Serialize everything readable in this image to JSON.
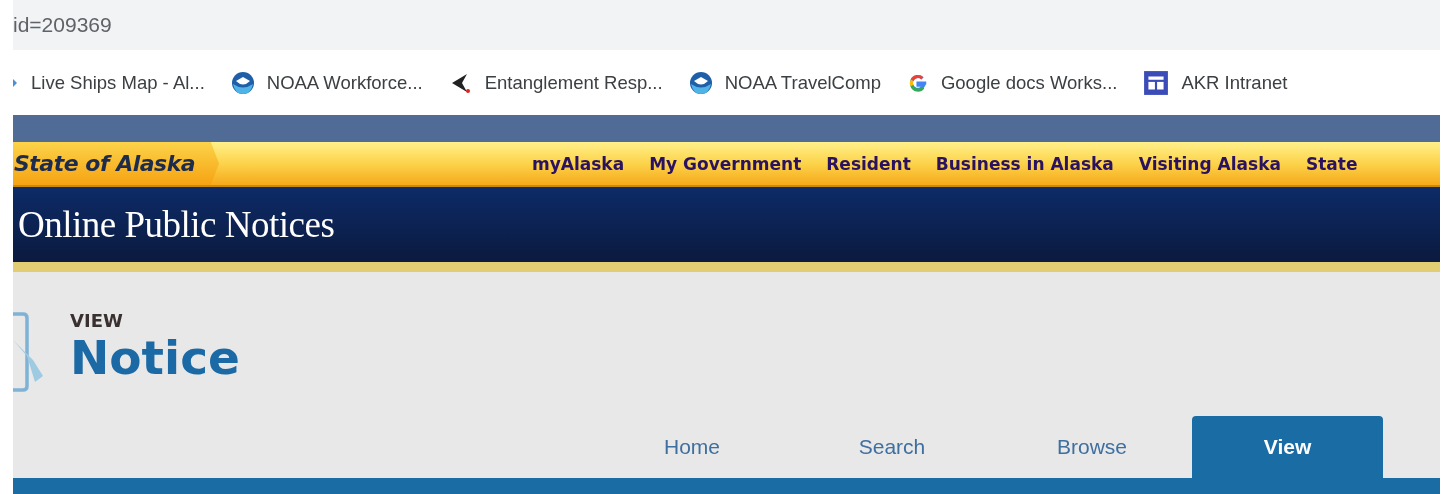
{
  "address_bar": {
    "url": "id=209369"
  },
  "bookmarks": [
    {
      "label": "Live Ships Map - Al...",
      "kind": "partial"
    },
    {
      "label": "NOAA Workforce...",
      "kind": "noaa"
    },
    {
      "label": "Entanglement Resp...",
      "kind": "tail"
    },
    {
      "label": "NOAA TravelComp",
      "kind": "noaa"
    },
    {
      "label": "Google docs Works...",
      "kind": "google"
    },
    {
      "label": "AKR Intranet",
      "kind": "intranet"
    }
  ],
  "brand_bar": {
    "logo": "State of Alaska",
    "links": [
      "myAlaska",
      "My Government",
      "Resident",
      "Business in Alaska",
      "Visiting Alaska",
      "State"
    ]
  },
  "banner": {
    "title": "Online Public Notices"
  },
  "page_header": {
    "kicker": "VIEW",
    "title": "Notice"
  },
  "tabs": [
    {
      "label": "Home",
      "selected": false
    },
    {
      "label": "Search",
      "selected": false
    },
    {
      "label": "Browse",
      "selected": false
    },
    {
      "label": "View",
      "selected": true
    }
  ]
}
